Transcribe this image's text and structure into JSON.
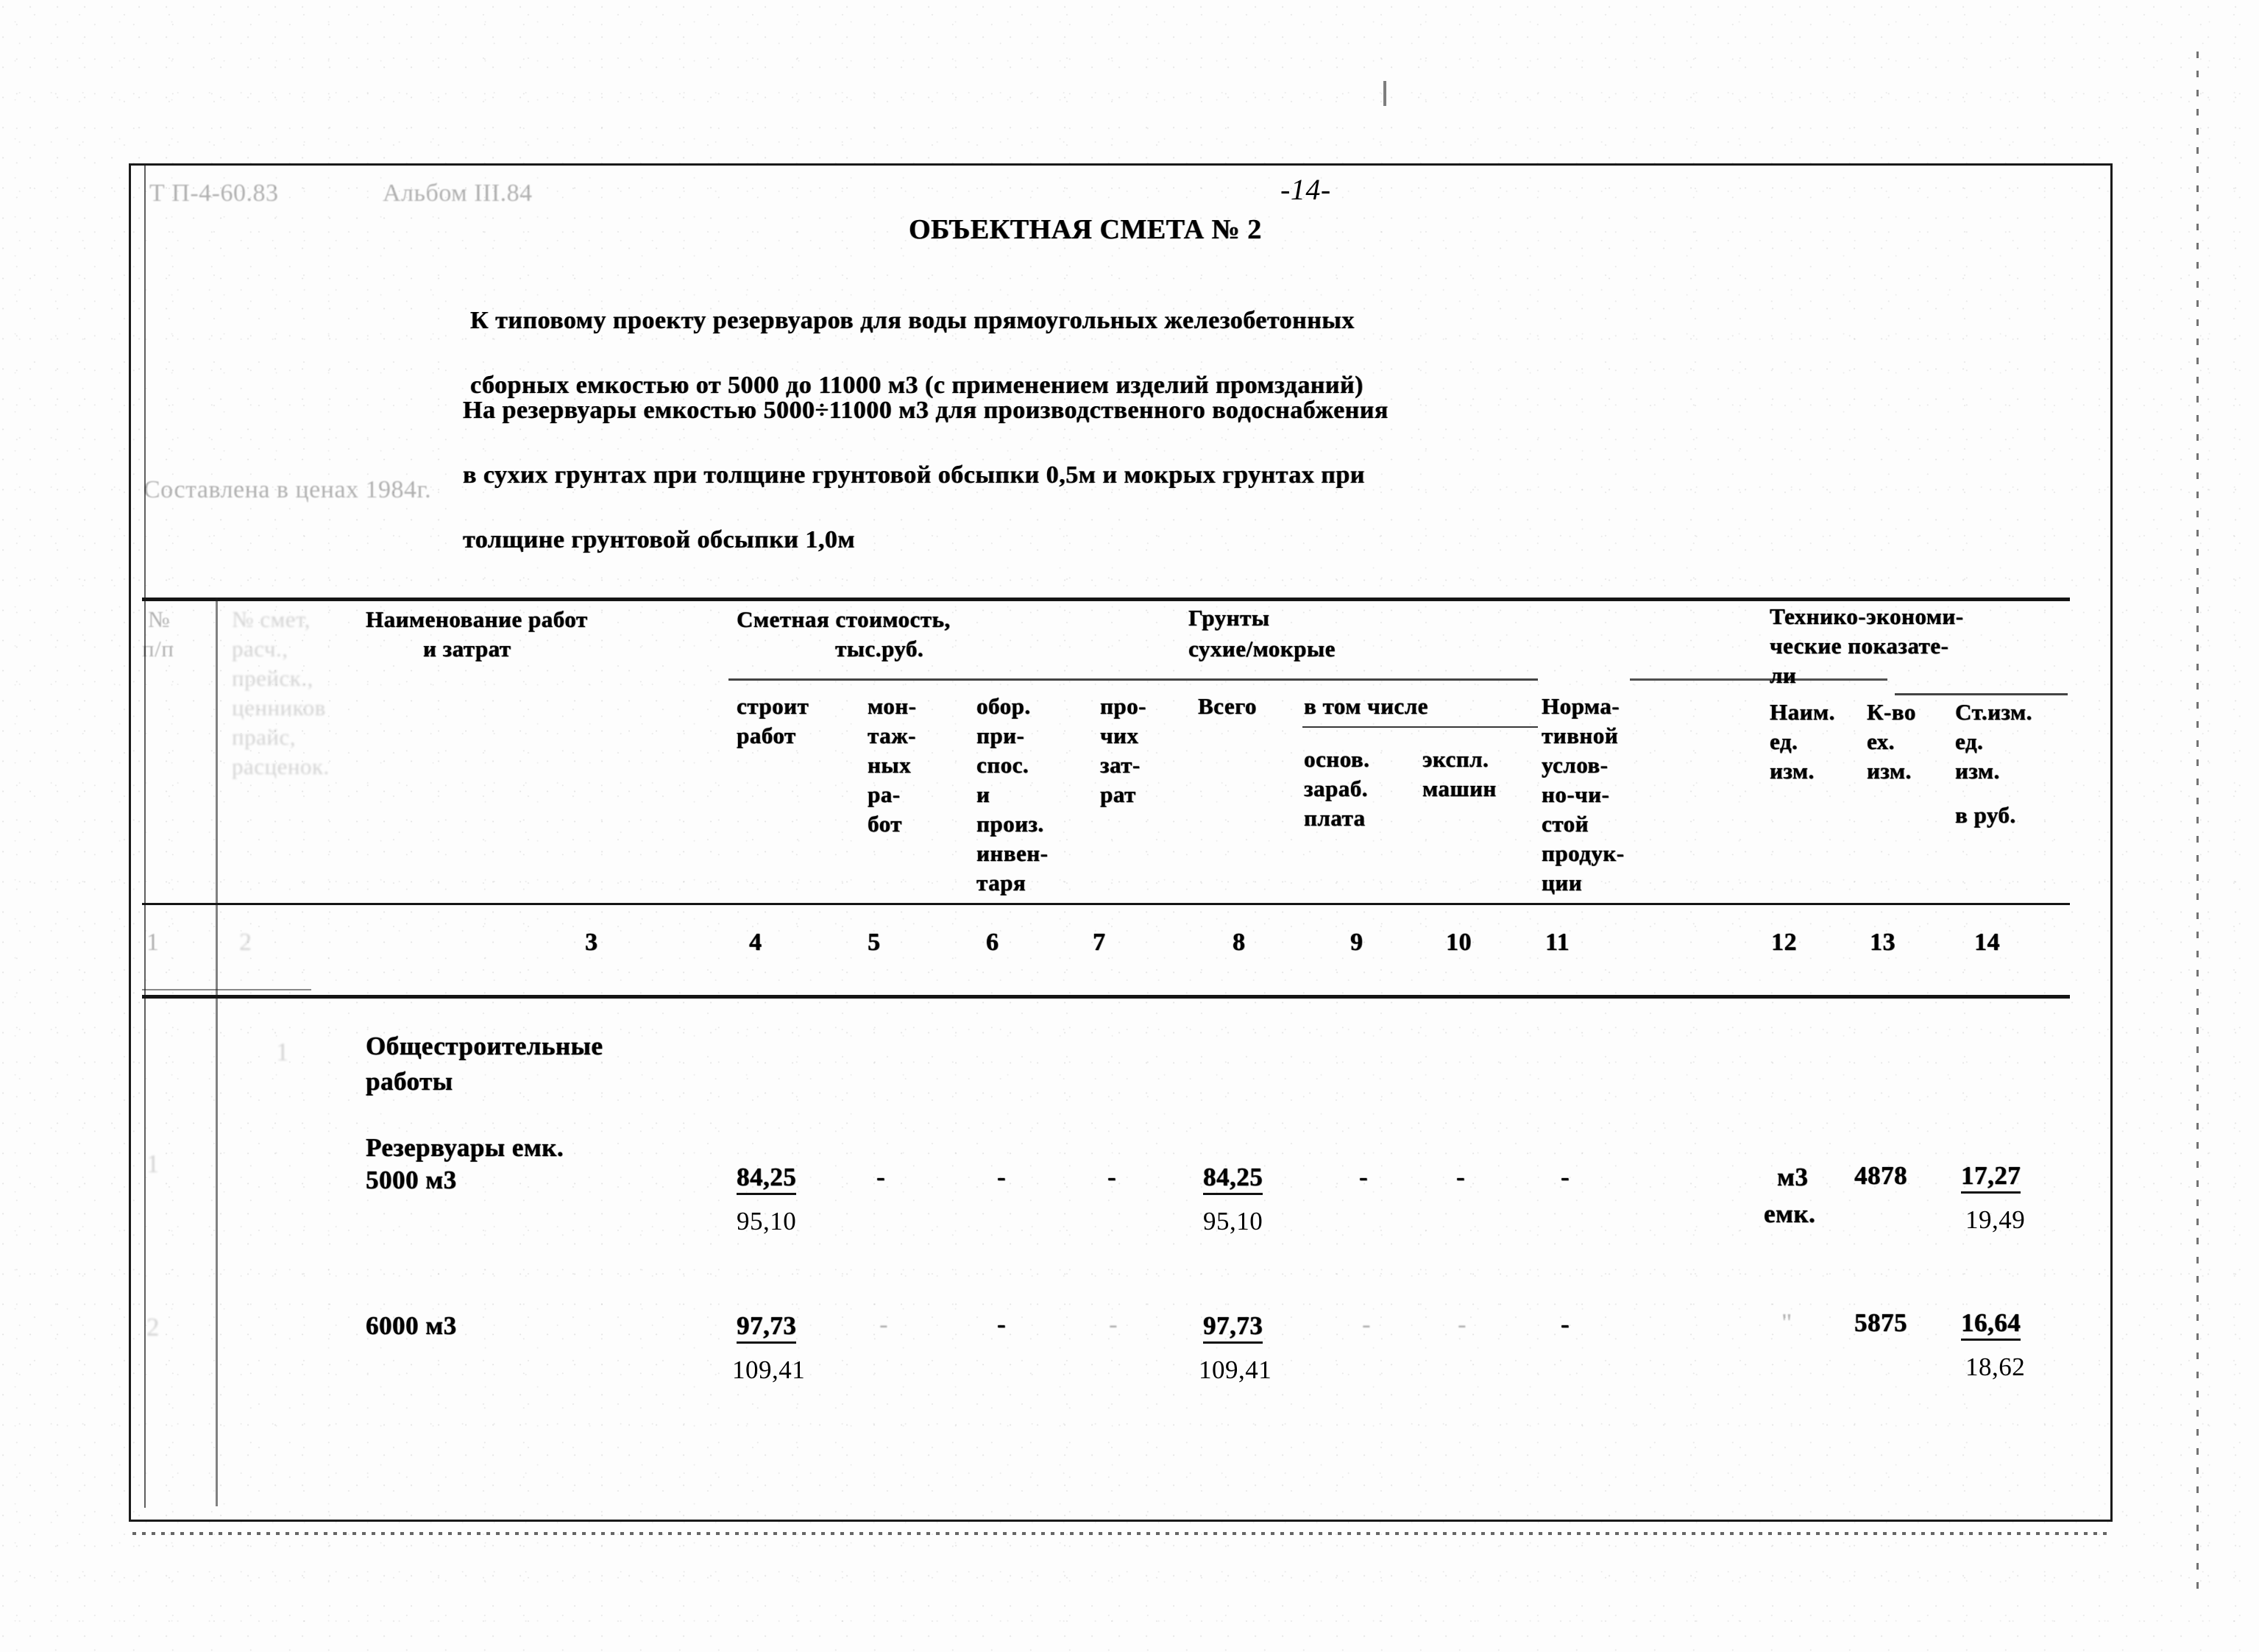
{
  "document": {
    "code": "Т П-4-60.83",
    "album": "Альбом III.84",
    "page_number": "-14-",
    "title": "ОБЪЕКТНАЯ СМЕТА № 2",
    "subtitle_line1": "К типовому проекту резервуаров для воды прямоугольных железобетонных",
    "subtitle_line2": "сборных емкостью от 5000 до 11000 м3 (с применением изделий промзданий)",
    "scope_line1": "На резервуары емкостью 5000÷11000 м3 для производственного водоснабжения",
    "scope_line2": "в сухих грунтах при толщине грунтовой обсыпки 0,5м и мокрых грунтах при",
    "scope_line3": "толщине грунтовой обсыпки 1,0м",
    "prices_note": "Составлена в ценах 1984г."
  },
  "table": {
    "group_headers": {
      "np_line1": "№",
      "np_line2": "п/п",
      "smetnomer_line1": "№ смет,",
      "smetnomer_line2": "расч.,",
      "smetnomer_line3": "прейск.,",
      "smetnomer_line4": "ценников",
      "smetnomer_line5": "прайс,",
      "smetnomer_line6": "расценок.",
      "naim_line1": "Наименование работ",
      "naim_line2": "и затрат",
      "smeta_line1": "Сметная стоимость,",
      "smeta_line2": "тыс.руб.",
      "grunty_line1": "Грунты",
      "grunty_line2": "сухие/мокрые",
      "teo_line1": "Технико-экономи-",
      "teo_line2": "ческие показате-",
      "teo_line3": "ли"
    },
    "sub_headers": {
      "stroit": [
        "строит",
        "работ"
      ],
      "montazh": [
        "мон-",
        "таж-",
        "ных",
        "ра-",
        "бот"
      ],
      "oborud": [
        "обор.",
        "при-",
        "спос.",
        "и",
        "произ.",
        "инвен-",
        "таря"
      ],
      "prochih": [
        "про-",
        "чих",
        "зат-",
        "рат"
      ],
      "vsego": [
        "Всего"
      ],
      "vtomchisle": [
        "в том числе"
      ],
      "osnovn": [
        "основ.",
        "зараб.",
        "плата"
      ],
      "ekspl": [
        "экспл.",
        "машин"
      ],
      "normativ": [
        "Норма-",
        "тивной",
        "услов-",
        "но-чи-",
        "стой",
        "продук-",
        "ции"
      ],
      "naim_ed": [
        "Наим.",
        "ед.",
        "изм."
      ],
      "kvo": [
        "К-во",
        "ех.",
        "изм."
      ],
      "stizm": [
        "Ст.изм.",
        "ед.",
        "изм.",
        "в руб."
      ]
    },
    "column_numbers": [
      "1",
      "2",
      "3",
      "4",
      "5",
      "6",
      "7",
      "8",
      "9",
      "10",
      "11",
      "12",
      "13",
      "14"
    ],
    "section": {
      "marker": "1",
      "name_line1": "Общестроительные",
      "name_line2": "работы"
    },
    "rows": [
      {
        "no": "1",
        "smeta_no": "",
        "name_line1": "Резервуары емк.",
        "name_line2": "5000 м3",
        "stroit_top": "84,25",
        "stroit_bottom": "95,10",
        "montazh": "-",
        "oborud": "-",
        "prochih": "-",
        "vsego_top": "84,25",
        "vsego_bottom": "95,10",
        "osnovn": "-",
        "ekspl": "-",
        "normativ": "-",
        "naim_ed_line1": "м3",
        "naim_ed_line2": "емк.",
        "kvo": "4878",
        "stizm_top": "17,27",
        "stizm_bottom": "19,49"
      },
      {
        "no": "2",
        "smeta_no": "",
        "name_line1": "",
        "name_line2": "6000 м3",
        "stroit_top": "97,73",
        "stroit_bottom": "109,41",
        "montazh": "-",
        "oborud": "-",
        "prochih": "-",
        "vsego_top": "97,73",
        "vsego_bottom": "109,41",
        "osnovn": "-",
        "ekspl": "-",
        "normativ": "-",
        "naim_ed_line1": "\"",
        "naim_ed_line2": "",
        "kvo": "5875",
        "stizm_top": "16,64",
        "stizm_bottom": "18,62"
      }
    ]
  }
}
